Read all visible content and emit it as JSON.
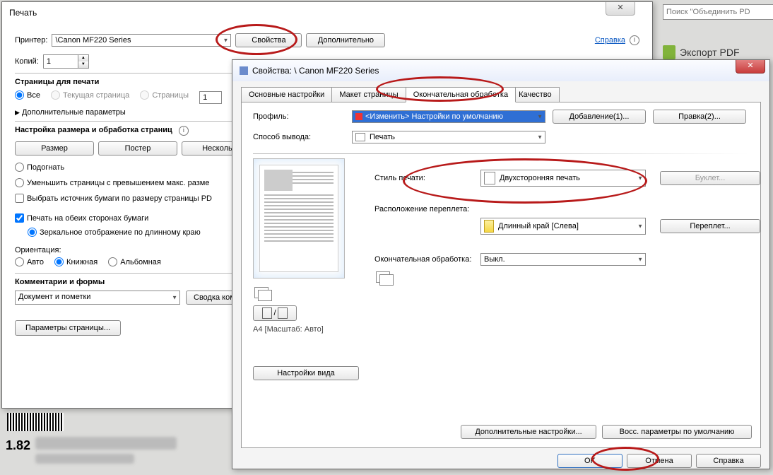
{
  "search_placeholder": "Поиск \"Объединить PD",
  "sidebar": {
    "export": "Экспорт PDF"
  },
  "print": {
    "title": "Печать",
    "printer_label": "Принтер:",
    "printer_value": "\\Canon MF220 Series",
    "properties": "Свойства",
    "advanced": "Дополнительно",
    "help": "Справка",
    "copies_label": "Копий:",
    "copies_value": "1",
    "pages_group": "Страницы для печати",
    "pages_all": "Все",
    "pages_current": "Текущая страница",
    "pages_range": "Страницы",
    "pages_range_value": "1",
    "show_more": "Дополнительные параметры",
    "sizing_group": "Настройка размера и обработка страниц",
    "btn_size": "Размер",
    "btn_poster": "Постер",
    "btn_multi": "Несколько",
    "fit": "Подогнать",
    "shrink": "Уменьшить страницы с превышением макс. разме",
    "source_by_size": "Выбрать источник бумаги по размеру страницы PD",
    "duplex": "Печать на обеих сторонах бумаги",
    "flip_long": "Зеркальное отображение по длинному краю",
    "orientation_label": "Ориентация:",
    "ori_auto": "Авто",
    "ori_portrait": "Книжная",
    "ori_landscape": "Альбомная",
    "comments_group": "Комментарии и формы",
    "comments_value": "Документ и пометки",
    "summary": "Сводка ком",
    "page_setup": "Параметры страницы..."
  },
  "bottom_number": "1.82",
  "props": {
    "title": "Свойства: \\         Canon MF220 Series",
    "tabs": [
      "Основные настройки",
      "Макет страницы",
      "Окончательная обработка",
      "Качество"
    ],
    "profile_label": "Профиль:",
    "profile_value": "<Изменить> Настройки по умолчанию",
    "add": "Добавление(1)...",
    "edit": "Правка(2)...",
    "output_label": "Способ вывода:",
    "output_value": "Печать",
    "style_label": "Стиль печати:",
    "style_value": "Двухсторонняя печать",
    "booklet": "Буклет...",
    "bind_label": "Расположение переплета:",
    "bind_value": "Длинный край [Слева]",
    "bind_btn": "Переплет...",
    "finishing_label": "Окончательная обработка:",
    "finishing_value": "Выкл.",
    "view_settings": "Настройки вида",
    "preview_caption": "A4 [Масштаб: Авто]",
    "more": "Дополнительные настройки...",
    "restore": "Восс. параметры по умолчанию",
    "ok": "OK",
    "cancel": "Отмена",
    "help": "Справка"
  }
}
